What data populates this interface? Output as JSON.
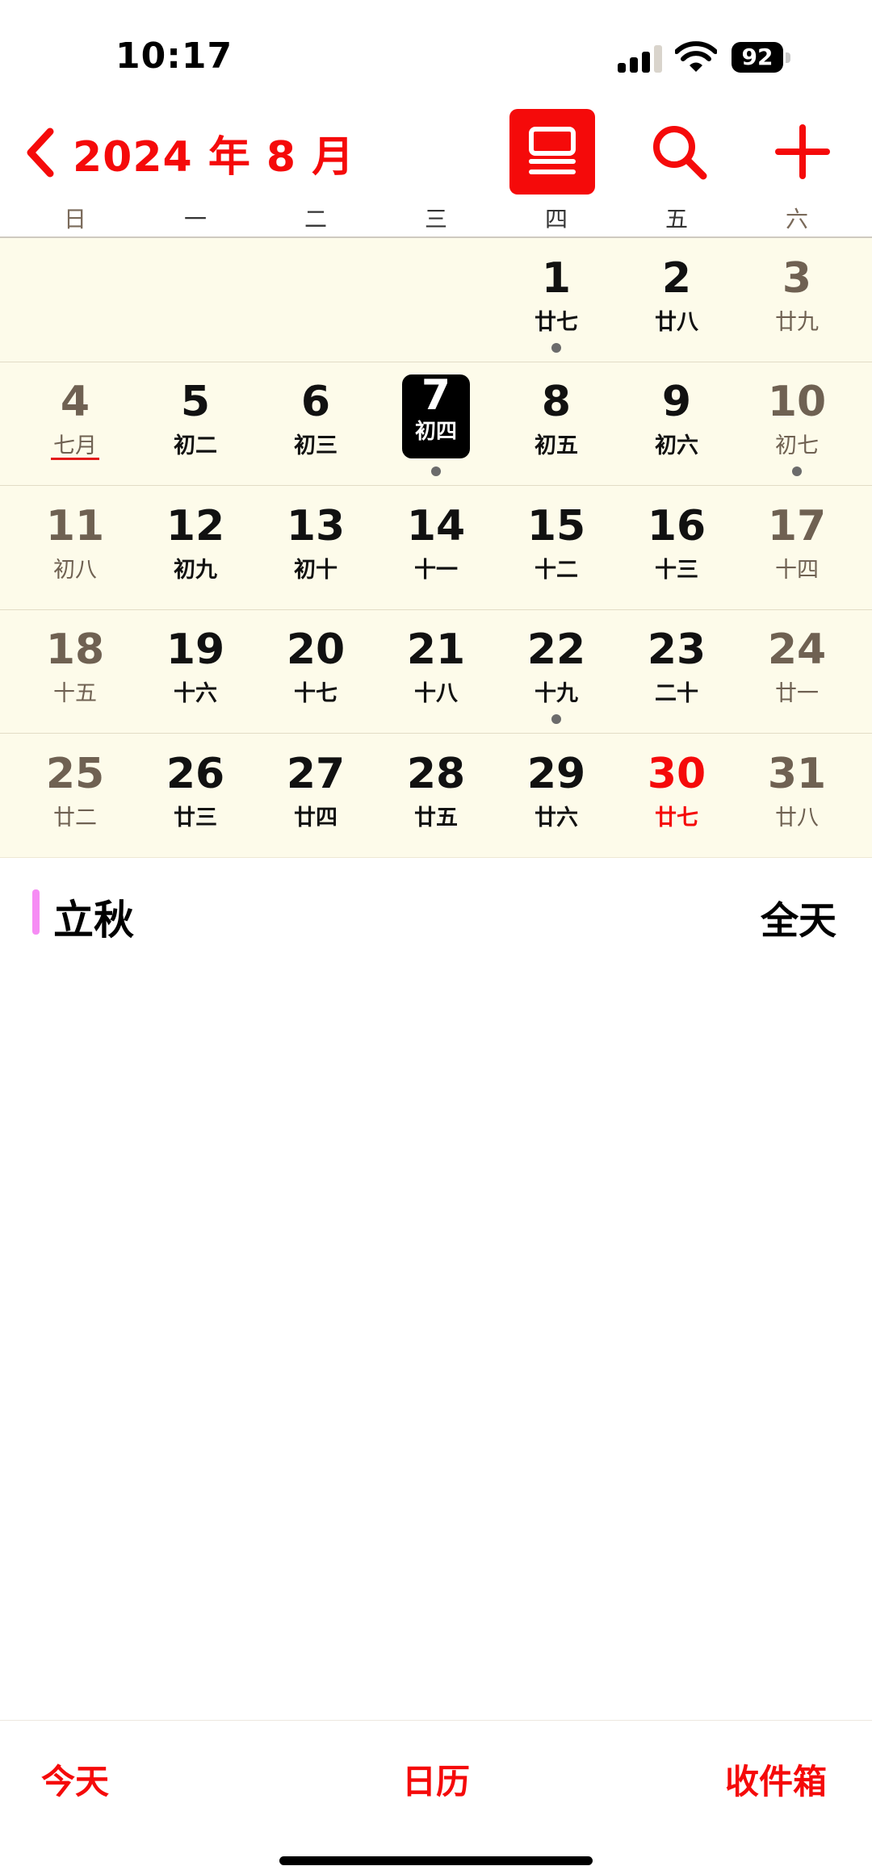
{
  "status": {
    "time": "10:17",
    "battery": "92"
  },
  "nav": {
    "title": "2024 年 8 月"
  },
  "weekdays": [
    "日",
    "一",
    "二",
    "三",
    "四",
    "五",
    "六"
  ],
  "weeks": [
    [
      null,
      null,
      null,
      null,
      {
        "day": "1",
        "lunar": "廿七",
        "dot": true
      },
      {
        "day": "2",
        "lunar": "廿八"
      },
      {
        "day": "3",
        "lunar": "廿九"
      }
    ],
    [
      {
        "day": "4",
        "lunar": "七月",
        "month_start": true
      },
      {
        "day": "5",
        "lunar": "初二"
      },
      {
        "day": "6",
        "lunar": "初三"
      },
      {
        "day": "7",
        "lunar": "初四",
        "today": true,
        "dot": true
      },
      {
        "day": "8",
        "lunar": "初五"
      },
      {
        "day": "9",
        "lunar": "初六"
      },
      {
        "day": "10",
        "lunar": "初七",
        "dot": true
      }
    ],
    [
      {
        "day": "11",
        "lunar": "初八"
      },
      {
        "day": "12",
        "lunar": "初九"
      },
      {
        "day": "13",
        "lunar": "初十"
      },
      {
        "day": "14",
        "lunar": "十一"
      },
      {
        "day": "15",
        "lunar": "十二"
      },
      {
        "day": "16",
        "lunar": "十三"
      },
      {
        "day": "17",
        "lunar": "十四"
      }
    ],
    [
      {
        "day": "18",
        "lunar": "十五"
      },
      {
        "day": "19",
        "lunar": "十六"
      },
      {
        "day": "20",
        "lunar": "十七"
      },
      {
        "day": "21",
        "lunar": "十八"
      },
      {
        "day": "22",
        "lunar": "十九",
        "dot": true
      },
      {
        "day": "23",
        "lunar": "二十"
      },
      {
        "day": "24",
        "lunar": "廿一"
      }
    ],
    [
      {
        "day": "25",
        "lunar": "廿二"
      },
      {
        "day": "26",
        "lunar": "廿三"
      },
      {
        "day": "27",
        "lunar": "廿四"
      },
      {
        "day": "28",
        "lunar": "廿五"
      },
      {
        "day": "29",
        "lunar": "廿六"
      },
      {
        "day": "30",
        "lunar": "廿七",
        "holiday": true
      },
      {
        "day": "31",
        "lunar": "廿八"
      }
    ]
  ],
  "events": [
    {
      "title": "立秋",
      "time": "全天",
      "color": "#f68cf4"
    }
  ],
  "tabs": {
    "today": "今天",
    "calendars": "日历",
    "inbox": "收件箱"
  },
  "colors": {
    "accent": "#f50a0a",
    "grid_bg": "#fdfbea",
    "event_dot": "#6b6b6b"
  },
  "icons": {
    "back": "chevron-left-icon",
    "list_view": "list-view-icon",
    "search": "search-icon",
    "add": "plus-icon"
  }
}
